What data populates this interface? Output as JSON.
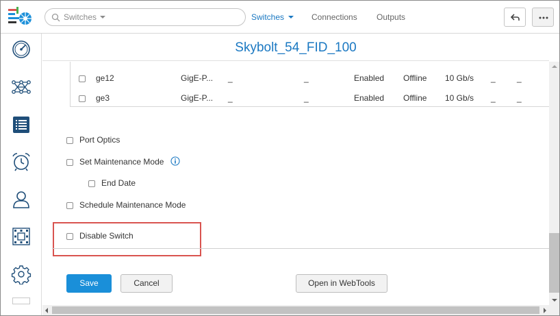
{
  "topbar": {
    "search_placeholder": "Switches",
    "nav": {
      "switches": "Switches",
      "connections": "Connections",
      "outputs": "Outputs"
    },
    "back_icon": "undo-arrow-icon",
    "more_icon": "more-dots-icon"
  },
  "sidebar": {
    "items": [
      {
        "icon": "dashboard-gauge-icon"
      },
      {
        "icon": "topology-network-icon"
      },
      {
        "icon": "inventory-list-icon",
        "active": true
      },
      {
        "icon": "alarm-clock-icon"
      },
      {
        "icon": "user-icon"
      },
      {
        "icon": "fabric-grid-icon"
      },
      {
        "icon": "settings-gear-icon"
      }
    ]
  },
  "page": {
    "title": "Skybolt_54_FID_100"
  },
  "ports": {
    "rows": [
      {
        "name": "ge12",
        "type": "GigE-P...",
        "c3": "_",
        "c4": "_",
        "state": "Enabled",
        "status": "Offline",
        "speed": "10 Gb/s",
        "c8": "_",
        "c9": "_"
      },
      {
        "name": "ge3",
        "type": "GigE-P...",
        "c3": "_",
        "c4": "_",
        "state": "Enabled",
        "status": "Offline",
        "speed": "10 Gb/s",
        "c8": "_",
        "c9": "_"
      }
    ]
  },
  "options": {
    "port_optics": "Port Optics",
    "set_maintenance_mode": "Set Maintenance Mode",
    "end_date": "End Date",
    "schedule_maintenance_mode": "Schedule Maintenance Mode",
    "disable_switch": "Disable Switch"
  },
  "buttons": {
    "save": "Save",
    "cancel": "Cancel",
    "open_webtools": "Open in WebTools"
  },
  "colors": {
    "accent": "#1a78c2",
    "primary_button": "#1a8fd9",
    "highlight": "#d9534f"
  }
}
